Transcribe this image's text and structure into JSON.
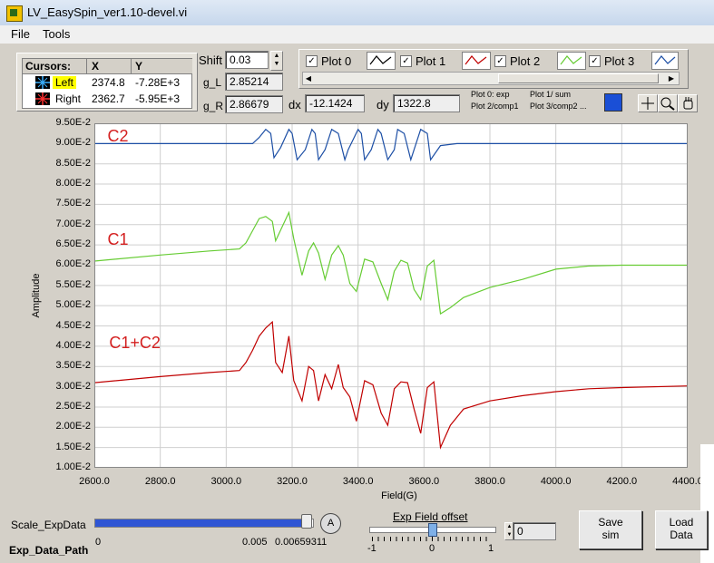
{
  "window": {
    "title": "LV_EasySpin_ver1.10-devel.vi"
  },
  "menu": {
    "file": "File",
    "tools": "Tools"
  },
  "cursors": {
    "header": "Cursors:",
    "col_x": "X",
    "col_y": "Y",
    "rows": [
      {
        "name": "Left",
        "x": "2374.8",
        "y": "-7.28E+3"
      },
      {
        "name": "Right",
        "x": "2362.7",
        "y": "-5.95E+3"
      }
    ]
  },
  "params": {
    "shift_label": "Shift",
    "shift_value": "0.03",
    "gl_label": "g_L",
    "gl_value": "2.85214",
    "gr_label": "g_R",
    "gr_value": "2.86679",
    "dx_label": "dx",
    "dx_value": "-12.1424",
    "dy_label": "dy",
    "dy_value": "1322.8"
  },
  "legend": {
    "items": [
      {
        "label": "Plot 0",
        "check": "✓",
        "color": "#000000"
      },
      {
        "label": "Plot 1",
        "check": "✓",
        "color": "#c00000"
      },
      {
        "label": "Plot 2",
        "check": "✓",
        "color": "#66cc33"
      },
      {
        "label": "Plot 3",
        "check": "✓",
        "color": "#1d4fa5"
      }
    ],
    "note_a": "Plot 0: exp",
    "note_b": "Plot 1/ sum",
    "note_c": "Plot 2/comp1",
    "note_d": "Plot 3/comp2 ...",
    "accent": "#1a4fd6"
  },
  "chart_data": {
    "type": "line",
    "xlabel": "Field(G)",
    "ylabel": "Amplitude",
    "xlim": [
      2600,
      4400
    ],
    "ylim": [
      0.01,
      0.095
    ],
    "x_ticks": [
      "2600.0",
      "2800.0",
      "3000.0",
      "3200.0",
      "3400.0",
      "3600.0",
      "3800.0",
      "4000.0",
      "4200.0",
      "4400.0"
    ],
    "y_ticks": [
      "1.00E-2",
      "1.50E-2",
      "2.00E-2",
      "2.50E-2",
      "3.00E-2",
      "3.50E-2",
      "4.00E-2",
      "4.50E-2",
      "5.00E-2",
      "5.50E-2",
      "6.00E-2",
      "6.50E-2",
      "7.00E-2",
      "7.50E-2",
      "8.00E-2",
      "8.50E-2",
      "9.00E-2",
      "9.50E-2"
    ],
    "annotations": [
      {
        "text": "C2",
        "x": 2640,
        "y": 0.0905
      },
      {
        "text": "C1",
        "x": 2640,
        "y": 0.065
      },
      {
        "text": "C1+C2",
        "x": 2645,
        "y": 0.0395
      }
    ],
    "series": [
      {
        "color": "#1d4fa5",
        "x": [
          2600,
          3080,
          3100,
          3120,
          3135,
          3145,
          3165,
          3190,
          3200,
          3215,
          3240,
          3260,
          3270,
          3280,
          3300,
          3320,
          3340,
          3360,
          3370,
          3400,
          3410,
          3420,
          3440,
          3460,
          3470,
          3490,
          3510,
          3520,
          3540,
          3560,
          3570,
          3590,
          3610,
          3620,
          3650,
          3700,
          4400
        ],
        "y": [
          0.09,
          0.09,
          0.0915,
          0.0935,
          0.0925,
          0.0865,
          0.089,
          0.0935,
          0.0925,
          0.086,
          0.0885,
          0.0935,
          0.0925,
          0.086,
          0.0885,
          0.0935,
          0.0925,
          0.086,
          0.0885,
          0.0935,
          0.0925,
          0.086,
          0.0885,
          0.0935,
          0.0925,
          0.086,
          0.0885,
          0.0935,
          0.0925,
          0.086,
          0.0885,
          0.0935,
          0.0925,
          0.086,
          0.0895,
          0.09,
          0.09
        ]
      },
      {
        "color": "#66cc33",
        "x": [
          2600,
          2800,
          2950,
          3040,
          3060,
          3080,
          3100,
          3120,
          3140,
          3150,
          3170,
          3190,
          3205,
          3230,
          3250,
          3265,
          3280,
          3300,
          3320,
          3340,
          3355,
          3375,
          3395,
          3420,
          3445,
          3470,
          3490,
          3510,
          3530,
          3550,
          3570,
          3590,
          3610,
          3630,
          3650,
          3680,
          3720,
          3800,
          3900,
          4000,
          4100,
          4200,
          4400
        ],
        "y": [
          0.061,
          0.0625,
          0.0635,
          0.064,
          0.0655,
          0.0685,
          0.0715,
          0.072,
          0.0708,
          0.066,
          0.0695,
          0.073,
          0.0665,
          0.0575,
          0.0635,
          0.0655,
          0.063,
          0.0565,
          0.0625,
          0.0648,
          0.0625,
          0.0555,
          0.0535,
          0.0615,
          0.0608,
          0.0555,
          0.0515,
          0.0585,
          0.0612,
          0.0605,
          0.054,
          0.0515,
          0.0598,
          0.0612,
          0.048,
          0.0495,
          0.052,
          0.0545,
          0.0565,
          0.059,
          0.0598,
          0.06,
          0.06
        ]
      },
      {
        "color": "#c00000",
        "x": [
          2600,
          2800,
          2950,
          3040,
          3060,
          3080,
          3100,
          3120,
          3140,
          3150,
          3170,
          3190,
          3205,
          3230,
          3250,
          3265,
          3280,
          3300,
          3320,
          3340,
          3355,
          3375,
          3395,
          3420,
          3445,
          3470,
          3490,
          3510,
          3530,
          3550,
          3570,
          3590,
          3610,
          3630,
          3650,
          3680,
          3720,
          3800,
          3900,
          4000,
          4100,
          4200,
          4400
        ],
        "y": [
          0.031,
          0.0325,
          0.0335,
          0.034,
          0.036,
          0.039,
          0.0425,
          0.0445,
          0.046,
          0.036,
          0.0335,
          0.0425,
          0.0315,
          0.0265,
          0.035,
          0.034,
          0.0265,
          0.033,
          0.0295,
          0.0355,
          0.0298,
          0.0275,
          0.0215,
          0.0315,
          0.0305,
          0.0235,
          0.0205,
          0.0295,
          0.0312,
          0.031,
          0.0245,
          0.0185,
          0.0298,
          0.0312,
          0.015,
          0.0205,
          0.0245,
          0.0265,
          0.0278,
          0.0288,
          0.0295,
          0.0298,
          0.0302
        ]
      }
    ]
  },
  "bottom": {
    "scale_label": "Scale_ExpData",
    "path_label": "Exp_Data_Path",
    "scale_min": "0",
    "scale_mid": "0.005",
    "scale_max": "0.00659311",
    "scale_fraction": 0.97,
    "a_button": "A",
    "offset_label": "Exp Field offset",
    "offset_min": "-1",
    "offset_zero": "0",
    "offset_max": "1",
    "offset_value": "0",
    "offset_fraction": 0.5,
    "save_line1": "Save",
    "save_line2": "sim",
    "load_line1": "Load",
    "load_line2": "Data"
  }
}
